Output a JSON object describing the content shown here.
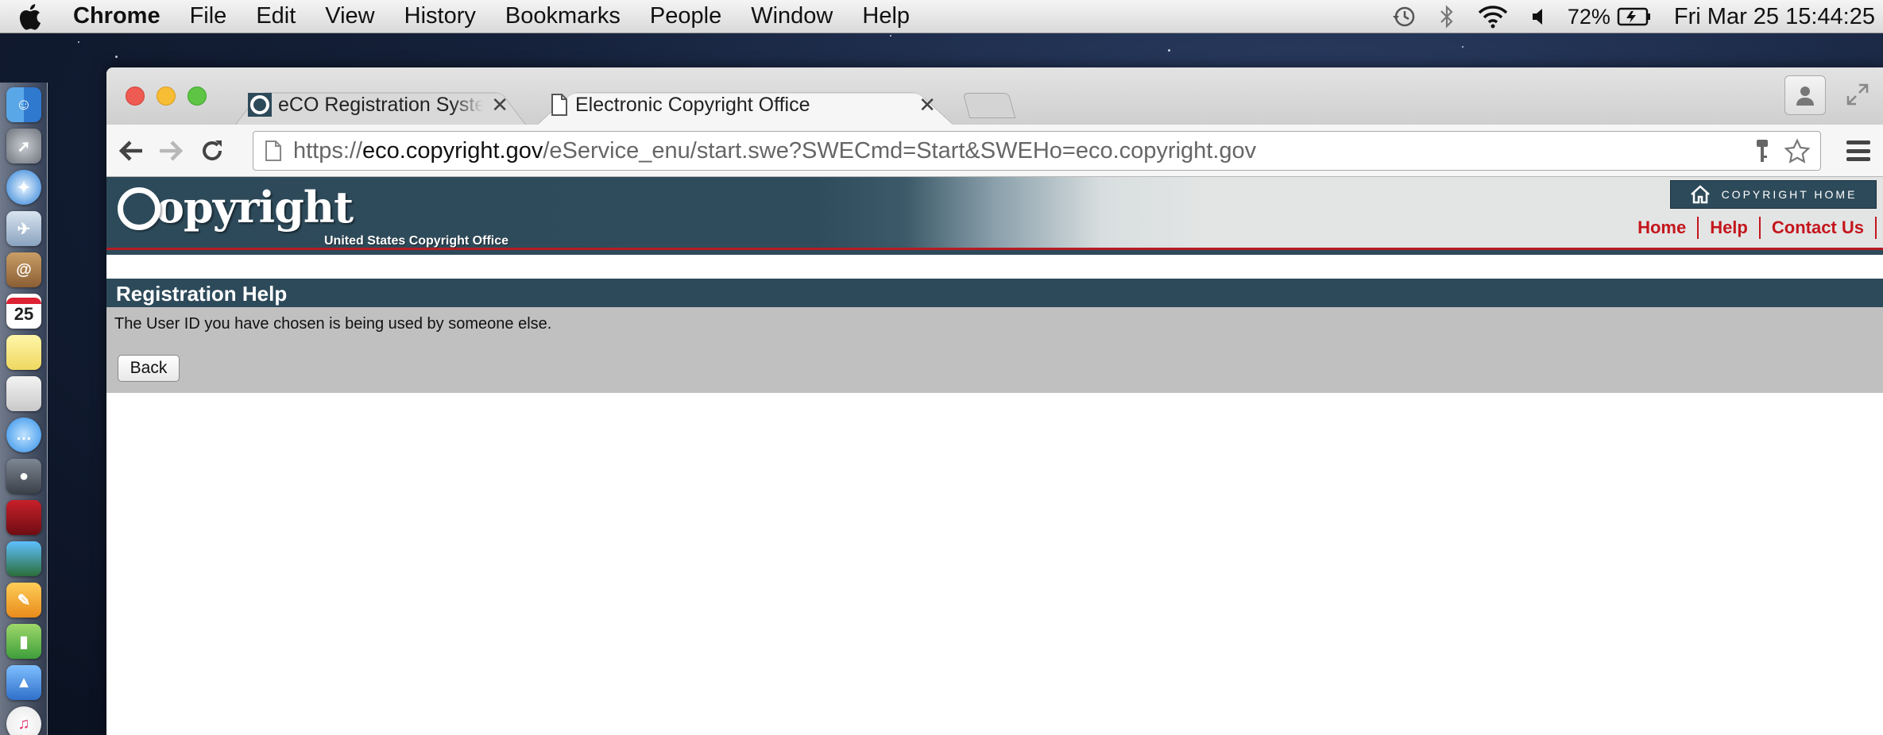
{
  "menubar": {
    "app_name": "Chrome",
    "items": [
      "File",
      "Edit",
      "View",
      "History",
      "Bookmarks",
      "People",
      "Window",
      "Help"
    ],
    "battery": "72%",
    "datetime": "Fri Mar 25  15:44:25"
  },
  "dock": {
    "items": [
      "finder-icon",
      "launchpad-icon",
      "safari-icon",
      "mail-icon",
      "contacts-icon",
      "calendar-icon",
      "notes-icon",
      "reminders-icon",
      "messages-icon",
      "facetime-icon",
      "photo-booth-icon",
      "iphoto-icon",
      "pages-icon",
      "numbers-icon",
      "keynote-icon",
      "itunes-icon"
    ],
    "calendar_day": "25"
  },
  "browser": {
    "tabs": [
      {
        "title": "eCO Registration System | U",
        "active": false
      },
      {
        "title": "Electronic Copyright Office",
        "active": true
      }
    ],
    "url_scheme": "https://",
    "url_host": "eco.copyright.gov",
    "url_path": "/eService_enu/start.swe?SWECmd=Start&SWEHo=eco.copyright.gov"
  },
  "site": {
    "logo_text": "opyright",
    "logo_sub": "United States Copyright Office",
    "home_badge": "COPYRIGHT HOME",
    "nav_links": [
      "Home",
      "Help",
      "Contact Us"
    ]
  },
  "page": {
    "heading": "Registration Help",
    "message": "The User ID you have chosen is being used by someone else.",
    "back_label": "Back"
  },
  "colors": {
    "header_dark": "#2d4a5a",
    "link_red": "#c4161c",
    "panel_gray": "#c0c0c0"
  }
}
